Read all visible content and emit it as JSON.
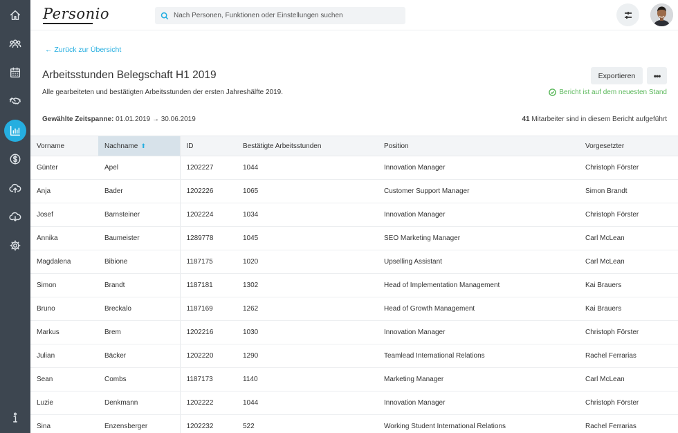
{
  "brand": {
    "logo_text": "Personio"
  },
  "search": {
    "placeholder": "Nach Personen, Funktionen oder Einstellungen suchen"
  },
  "sidebar": {
    "items": [
      {
        "icon": "home-icon"
      },
      {
        "icon": "people-icon"
      },
      {
        "icon": "calendar-icon"
      },
      {
        "icon": "handshake-icon"
      },
      {
        "icon": "reports-icon",
        "active": true
      },
      {
        "icon": "dollar-icon"
      },
      {
        "icon": "cloud-upload-icon"
      },
      {
        "icon": "cloud-download-icon"
      },
      {
        "icon": "gear-icon"
      },
      {
        "icon": "info-icon"
      }
    ]
  },
  "header": {
    "back_link": "← Zurück zur Übersicht",
    "title": "Arbeitsstunden Belegschaft H1 2019",
    "description": "Alle gearbeiteten und bestätigten Arbeitsstunden der ersten Jahreshälfte 2019.",
    "export_label": "Exportieren",
    "more_label": "•••",
    "status_text": "Bericht ist auf dem neuesten Stand",
    "range_label": "Gewählte Zeitspanne:",
    "range_value": " 01.01.2019 → 30.06.2019",
    "count_value": "41",
    "count_text": " Mitarbeiter sind in diesem Bericht aufgeführt"
  },
  "table": {
    "columns": [
      "Vorname",
      "Nachname",
      "ID",
      "Bestätigte Arbeitsstunden",
      "Position",
      "Vorgesetzter"
    ],
    "sort_arrow": "⬆",
    "rows": [
      [
        "Günter",
        "Apel",
        "1202227",
        "1044",
        "Innovation Manager",
        "Christoph Förster"
      ],
      [
        "Anja",
        "Bader",
        "1202226",
        "1065",
        "Customer Support Manager",
        "Simon Brandt"
      ],
      [
        "Josef",
        "Barnsteiner",
        "1202224",
        "1034",
        "Innovation Manager",
        "Christoph Förster"
      ],
      [
        "Annika",
        "Baumeister",
        "1289778",
        "1045",
        "SEO Marketing Manager",
        "Carl McLean"
      ],
      [
        "Magdalena",
        "Bibione",
        "1187175",
        "1020",
        "Upselling Assistant",
        "Carl McLean"
      ],
      [
        "Simon",
        "Brandt",
        "1187181",
        "1302",
        "Head of Implementation Management",
        "Kai Brauers"
      ],
      [
        "Bruno",
        "Breckalo",
        "1187169",
        "1262",
        "Head of Growth Management",
        "Kai Brauers"
      ],
      [
        "Markus",
        "Brem",
        "1202216",
        "1030",
        "Innovation Manager",
        "Christoph Förster"
      ],
      [
        "Julian",
        "Bäcker",
        "1202220",
        "1290",
        "Teamlead International Relations",
        "Rachel Ferrarias"
      ],
      [
        "Sean",
        "Combs",
        "1187173",
        "1140",
        "Marketing Manager",
        "Carl McLean"
      ],
      [
        "Luzie",
        "Denkmann",
        "1202222",
        "1044",
        "Innovation Manager",
        "Christoph Förster"
      ],
      [
        "Sina",
        "Enzensberger",
        "1202232",
        "522",
        "Working Student International Relations",
        "Rachel Ferrarias"
      ]
    ]
  }
}
